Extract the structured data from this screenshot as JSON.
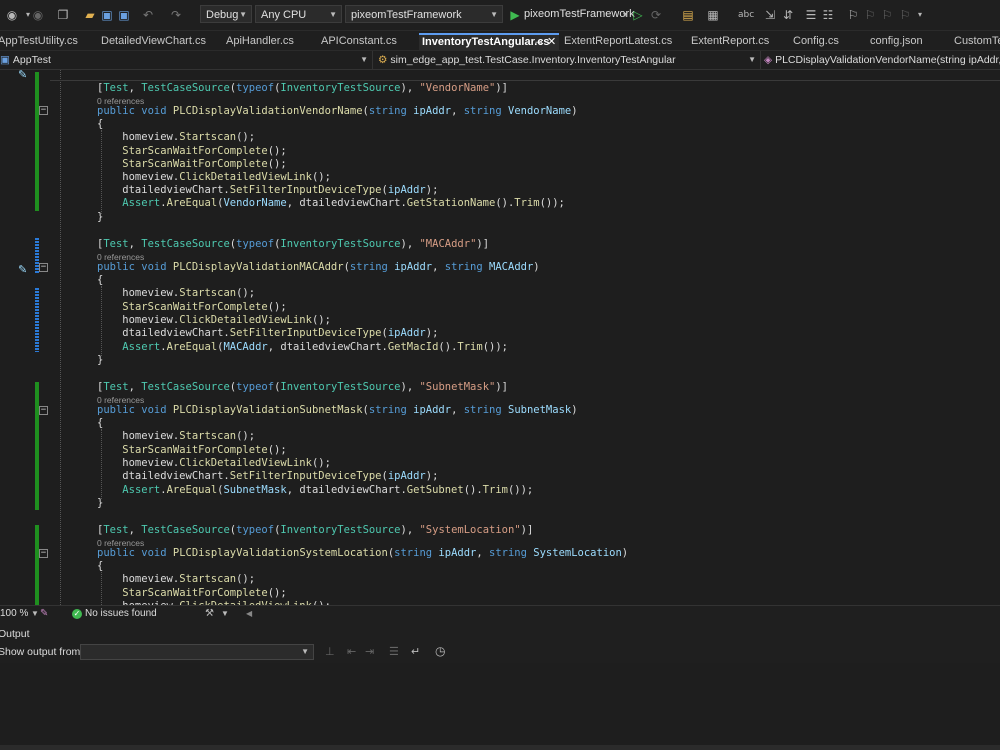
{
  "toolbar": {
    "config": "Debug",
    "platform": "Any CPU",
    "startup_project": "pixeomTestFramework",
    "run_target": "pixeomTestFramework"
  },
  "tabs": [
    {
      "label": "AppTestUtility.cs"
    },
    {
      "label": "DetailedViewChart.cs"
    },
    {
      "label": "ApiHandler.cs"
    },
    {
      "label": "APIConstant.cs"
    },
    {
      "label": "InventoryTestAngular.cs",
      "active": true
    },
    {
      "label": "ExtentReportLatest.cs"
    },
    {
      "label": "ExtentReport.cs"
    },
    {
      "label": "Config.cs"
    },
    {
      "label": "config.json"
    },
    {
      "label": "CustomTes"
    }
  ],
  "navbar": {
    "project": "AppTest",
    "class": "sim_edge_app_test.TestCase.Inventory.InventoryTestAngular",
    "member": "PLCDisplayValidationVendorName(string ipAddr, string"
  },
  "code": {
    "references_label": "0 references",
    "methods": [
      {
        "attr_source": "InventoryTestSource",
        "attr_case": "VendorName",
        "name": "PLCDisplayValidationVendorName",
        "param1": "ipAddr",
        "param2": "VendorName",
        "getter": "GetStationName"
      },
      {
        "attr_source": "InventoryTestSource",
        "attr_case": "MACAddr",
        "name": "PLCDisplayValidationMACAddr",
        "param1": "ipAddr",
        "param2": "MACAddr",
        "getter": "GetMacId"
      },
      {
        "attr_source": "InventoryTestSource",
        "attr_case": "SubnetMask",
        "name": "PLCDisplayValidationSubnetMask",
        "param1": "ipAddr",
        "param2": "SubnetMask",
        "getter": "GetSubnet"
      },
      {
        "attr_source": "InventoryTestSource",
        "attr_case": "SystemLocation",
        "name": "PLCDisplayValidationSystemLocation",
        "param1": "ipAddr",
        "param2": "SystemLocation",
        "getter": ""
      }
    ]
  },
  "status": {
    "zoom": "100 %",
    "issues": "No issues found"
  },
  "output": {
    "title": "Output",
    "show_from_label": "Show output from:",
    "source_value": ""
  },
  "colors": {
    "keyword": "#569cd6",
    "type": "#4ec9b0",
    "method": "#dcdcaa",
    "string": "#d69d85",
    "param": "#9cdcfe",
    "change_saved": "#1f8f1f",
    "change_unsaved": "#2a7ad8",
    "ok": "#3fb950"
  }
}
